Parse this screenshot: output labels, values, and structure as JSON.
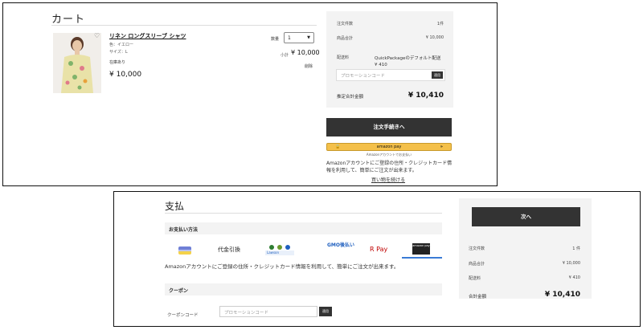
{
  "cart": {
    "title": "カート",
    "product": {
      "name": "リネン ロングスリーブ シャツ",
      "color": "色：イエロー",
      "size": "サイズ：L",
      "stock": "在庫あり",
      "price": "¥ 10,000",
      "quantity_label": "数量",
      "quantity_value": "1",
      "subtotal_label": "小計",
      "subtotal_value": "¥ 10,000",
      "delete_label": "削除"
    },
    "summary": {
      "item_count_label": "注文件数",
      "item_count_value": "1件",
      "subtotal_label": "商品合計",
      "subtotal_value": "¥ 10,000",
      "shipping_label": "配送料",
      "shipping_method": "QuickPackageのデフォルト配送",
      "shipping_value": "¥ 410",
      "promo_placeholder": "プロモーションコード",
      "promo_button": "適用",
      "total_label": "推定合計金額",
      "total_value": "¥ 10,410"
    },
    "checkout_button": "注文手続きへ",
    "amazon_pay": {
      "logo": "amazon pay",
      "arrow": "»",
      "sub": "Amazonアカウントでお支払い",
      "note": "Amazonアカウントにご登録の住所・クレジットカード情報を利用して、簡単にご注文が出来ます。"
    },
    "continue_link": "買い物を続ける"
  },
  "payment": {
    "title": "支払",
    "methods_heading": "お支払い方法",
    "methods": [
      {
        "name": "card",
        "label": "CARD"
      },
      {
        "name": "cod",
        "label": "代金引換"
      },
      {
        "name": "lawson",
        "label": "Lawson"
      },
      {
        "name": "gmo",
        "label": "GMO後払い"
      },
      {
        "name": "rpay",
        "label": "R Pay"
      },
      {
        "name": "amazonpay",
        "label": "amazon pay"
      }
    ],
    "note": "Amazonアカウントにご登録の住所・クレジットカード情報を利用して、簡単にご注文が出来ます。",
    "coupon_heading": "クーポン",
    "coupon_label": "クーポンコード",
    "promo_placeholder": "プロモーションコード",
    "promo_button": "適用",
    "summary": {
      "next_button": "次へ",
      "item_count_label": "注文件数",
      "item_count_value": "1 件",
      "subtotal_label": "商品合計",
      "subtotal_value": "¥ 10,000",
      "shipping_label": "配送料",
      "shipping_value": "¥ 410",
      "total_label": "合計金額",
      "total_value": "¥ 10,410"
    }
  },
  "colors": {
    "dark_button": "#333333",
    "panel_bg": "#f3f3f3",
    "amazon_yellow": "#f4c04a",
    "rpay_red": "#bf0000",
    "gmo_blue": "#1f5fbf"
  },
  "icons": {
    "favorite": "heart-icon",
    "dropdown": "chevron-down-icon"
  }
}
